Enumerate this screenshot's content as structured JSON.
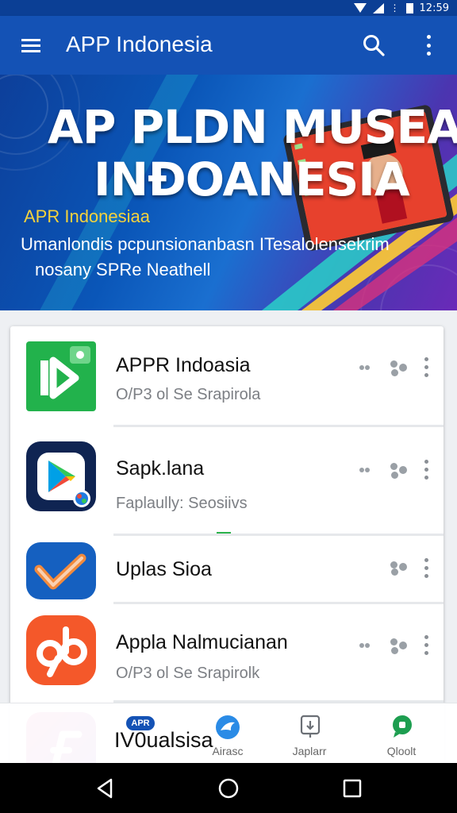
{
  "status_bar": {
    "time": "12:59"
  },
  "app_bar": {
    "title": "APP Indonesia"
  },
  "hero": {
    "title_line1": "AP PLDN MUSEA",
    "title_line2": "INĐOANESIA",
    "subtitle": "APR Indonesiaa",
    "description_line1": "Umanlondis pcpunsionanbasn ITesalolensekrim",
    "description_line2": "nosany SPRe Neathell"
  },
  "apps": [
    {
      "name": "APPR Indoasia",
      "subtitle": "O/P3 ol Se Srapirola",
      "icon": "play-d-app-icon",
      "color": "#22b24c"
    },
    {
      "name": "Sapk.lana",
      "subtitle": "Faplaully: Seosiivs",
      "icon": "play-store-icon",
      "color": "#0f2452"
    },
    {
      "name": "Uplas Sioa",
      "subtitle": "",
      "icon": "check-arrow-app-icon",
      "color": "#1560c0"
    },
    {
      "name": "Appla Nalmucianan",
      "subtitle": "O/P3 ol Se Srapirolk",
      "icon": "ob-app-icon",
      "color": "#f4582a"
    },
    {
      "name": "IV0ualsisa",
      "subtitle": "",
      "icon": "f-app-icon",
      "color": "#7a1ca6"
    }
  ],
  "bottom_nav": {
    "badge": "APR",
    "items": [
      {
        "label": "",
        "icon": "app-badge-icon"
      },
      {
        "label": "Airasc",
        "icon": "bird-icon"
      },
      {
        "label": "Japlarr",
        "icon": "download-icon"
      },
      {
        "label": "Qloolt",
        "icon": "chat-icon"
      }
    ]
  }
}
